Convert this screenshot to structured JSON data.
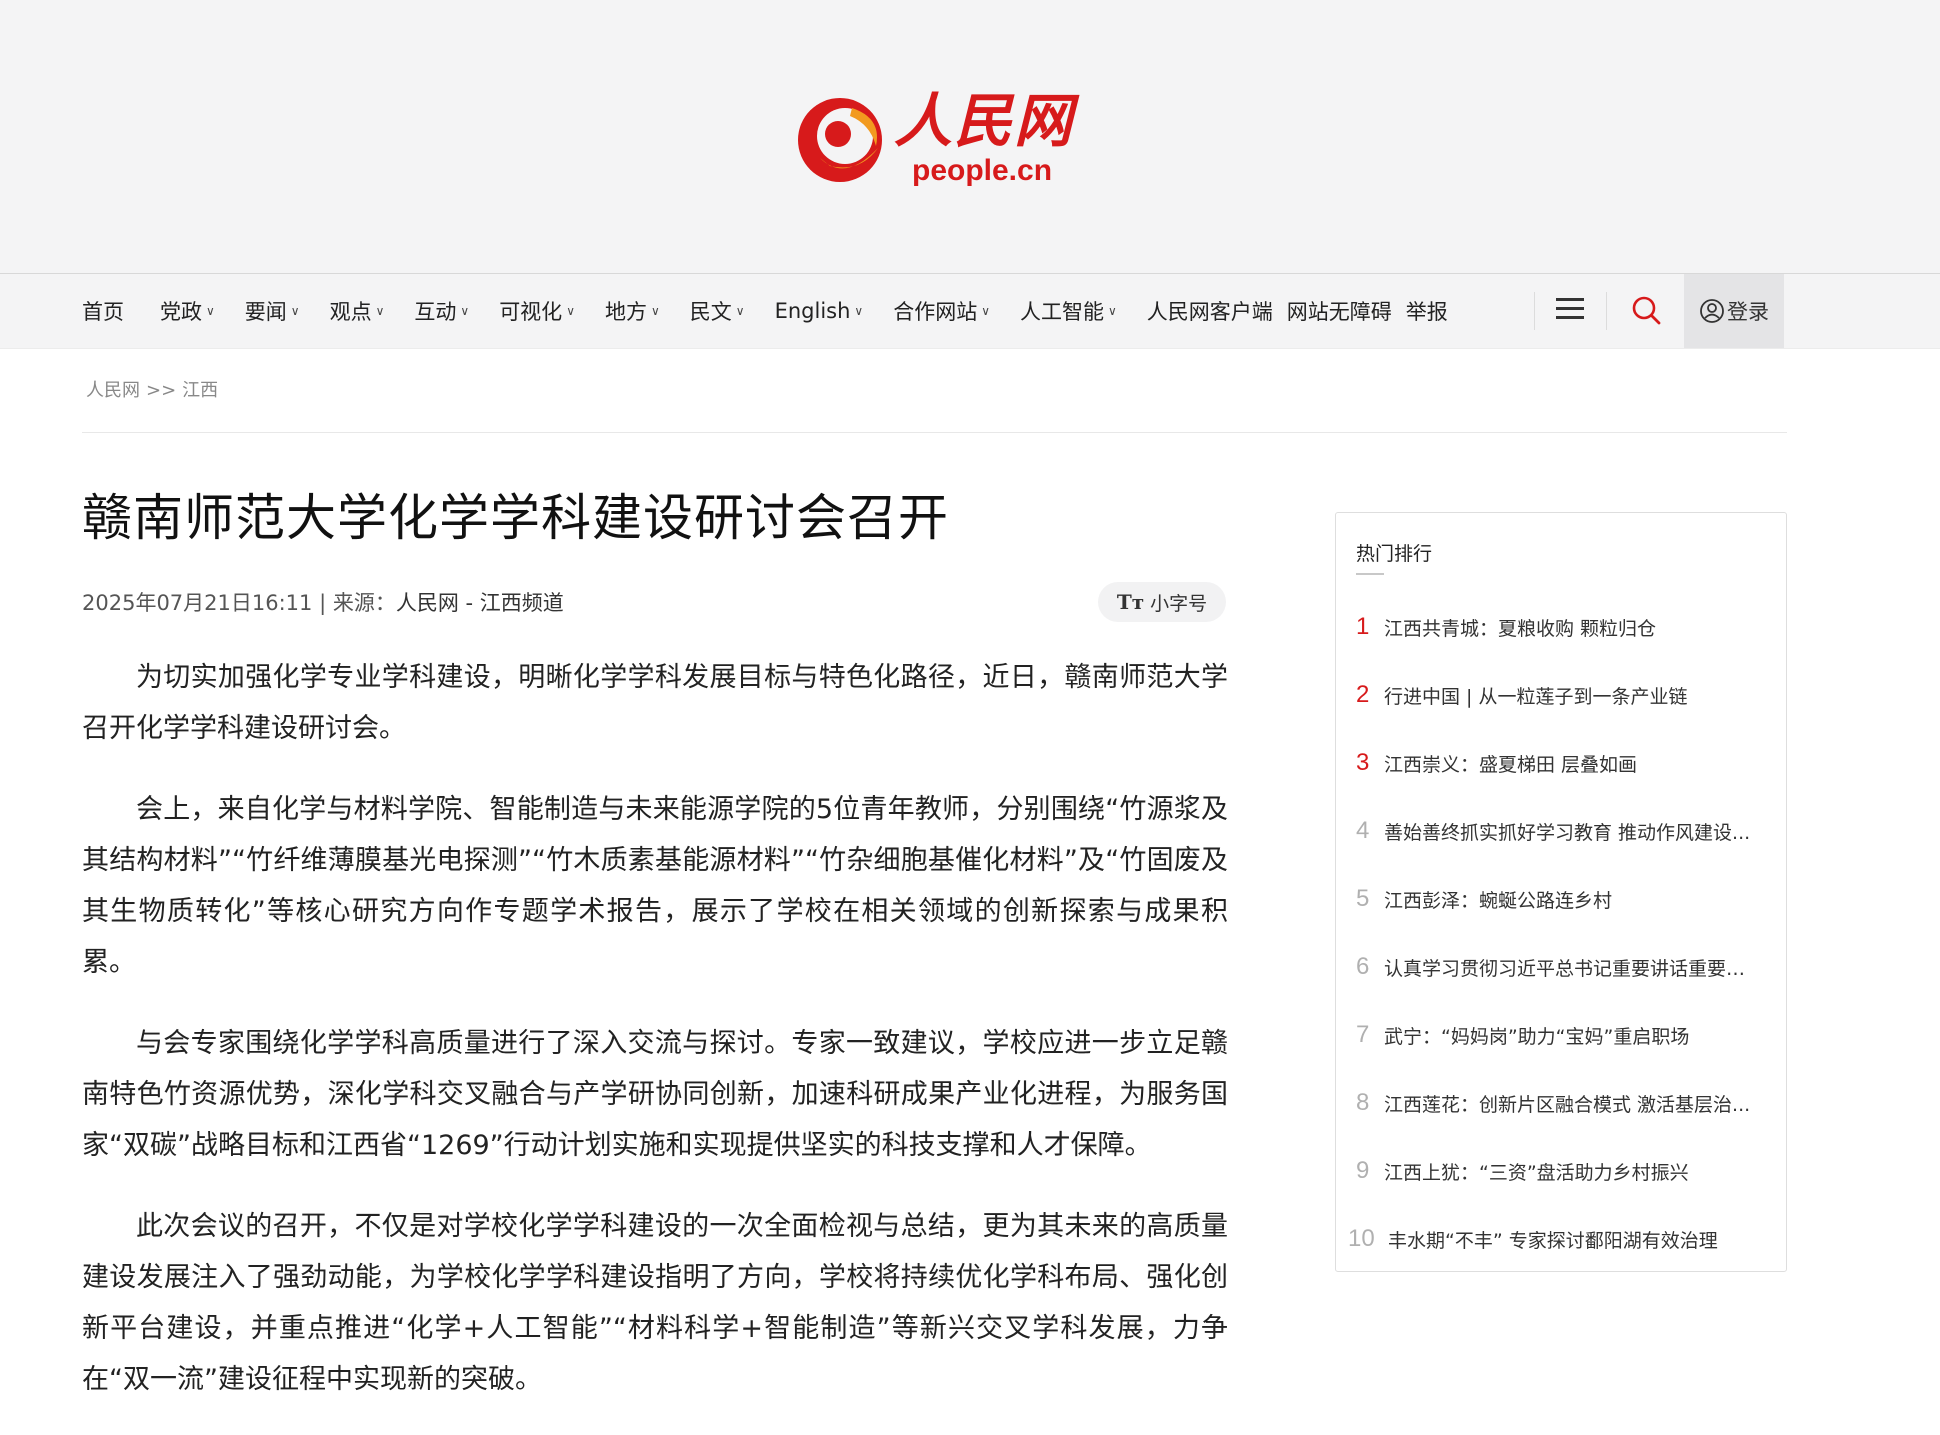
{
  "header": {
    "logo_cn": "人民网",
    "logo_en": "people.cn"
  },
  "nav": {
    "items": [
      {
        "label": "首页",
        "has_caret": false
      },
      {
        "label": "党政",
        "has_caret": true
      },
      {
        "label": "要闻",
        "has_caret": true
      },
      {
        "label": "观点",
        "has_caret": true
      },
      {
        "label": "互动",
        "has_caret": true
      },
      {
        "label": "可视化",
        "has_caret": true
      },
      {
        "label": "地方",
        "has_caret": true
      },
      {
        "label": "民文",
        "has_caret": true
      },
      {
        "label": "English",
        "has_caret": true
      },
      {
        "label": "合作网站",
        "has_caret": true
      },
      {
        "label": "人工智能",
        "has_caret": true
      },
      {
        "label": "人民网客户端",
        "has_caret": false
      },
      {
        "label": "网站无障碍",
        "has_caret": false
      },
      {
        "label": "举报",
        "has_caret": false
      }
    ],
    "menu_icon": "hamburger-icon",
    "search_icon": "search-icon",
    "login_label": "登录",
    "brand_color": "#d71a1b"
  },
  "breadcrumb": {
    "home": "人民网",
    "separator": ">>",
    "section": "江西"
  },
  "article": {
    "title": "赣南师范大学化学学科建设研讨会召开",
    "date": "2025年07月21日16:11",
    "source_sep": " | 来源：",
    "source": "人民网 - 江西频道",
    "font_toggle_icon": "Tт",
    "font_toggle_label": "小字号",
    "paragraphs": [
      "为切实加强化学专业学科建设，明晰化学学科发展目标与特色化路径，近日，赣南师范大学召开化学学科建设研讨会。",
      "会上，来自化学与材料学院、智能制造与未来能源学院的5位青年教师，分别围绕“竹源浆及其结构材料”“竹纤维薄膜基光电探测”“竹木质素基能源材料”“竹杂细胞基催化材料”及“竹固废及其生物质转化”等核心研究方向作专题学术报告，展示了学校在相关领域的创新探索与成果积累。",
      "与会专家围绕化学学科高质量进行了深入交流与探讨。专家一致建议，学校应进一步立足赣南特色竹资源优势，深化学科交叉融合与产学研协同创新，加速科研成果产业化进程，为服务国家“双碳”战略目标和江西省“1269”行动计划实施和实现提供坚实的科技支撑和人才保障。",
      "此次会议的召开，不仅是对学校化学学科建设的一次全面检视与总结，更为其未来的高质量建设发展注入了强劲动能，为学校化学学科建设指明了方向，学校将持续优化学科布局、强化创新平台建设，并重点推进“化学+人工智能”“材料科学+智能制造”等新兴交叉学科发展，力争在“双一流”建设征程中实现新的突破。"
    ]
  },
  "sidebar": {
    "title": "热门排行",
    "items": [
      {
        "rank": "1",
        "text": "江西共青城：夏粮收购 颗粒归仓"
      },
      {
        "rank": "2",
        "text": "行进中国 | 从一粒莲子到一条产业链"
      },
      {
        "rank": "3",
        "text": "江西崇义：盛夏梯田 层叠如画"
      },
      {
        "rank": "4",
        "text": "善始善终抓实抓好学习教育 推动作风建设..."
      },
      {
        "rank": "5",
        "text": "江西彭泽：蜿蜒公路连乡村"
      },
      {
        "rank": "6",
        "text": "认真学习贯彻习近平总书记重要讲话重要指..."
      },
      {
        "rank": "7",
        "text": "武宁：“妈妈岗”助力“宝妈”重启职场"
      },
      {
        "rank": "8",
        "text": "江西莲花：创新片区融合模式 激活基层治..."
      },
      {
        "rank": "9",
        "text": "江西上犹：“三资”盘活助力乡村振兴"
      },
      {
        "rank": "10",
        "text": "丰水期“不丰” 专家探讨鄱阳湖有效治理"
      }
    ]
  }
}
